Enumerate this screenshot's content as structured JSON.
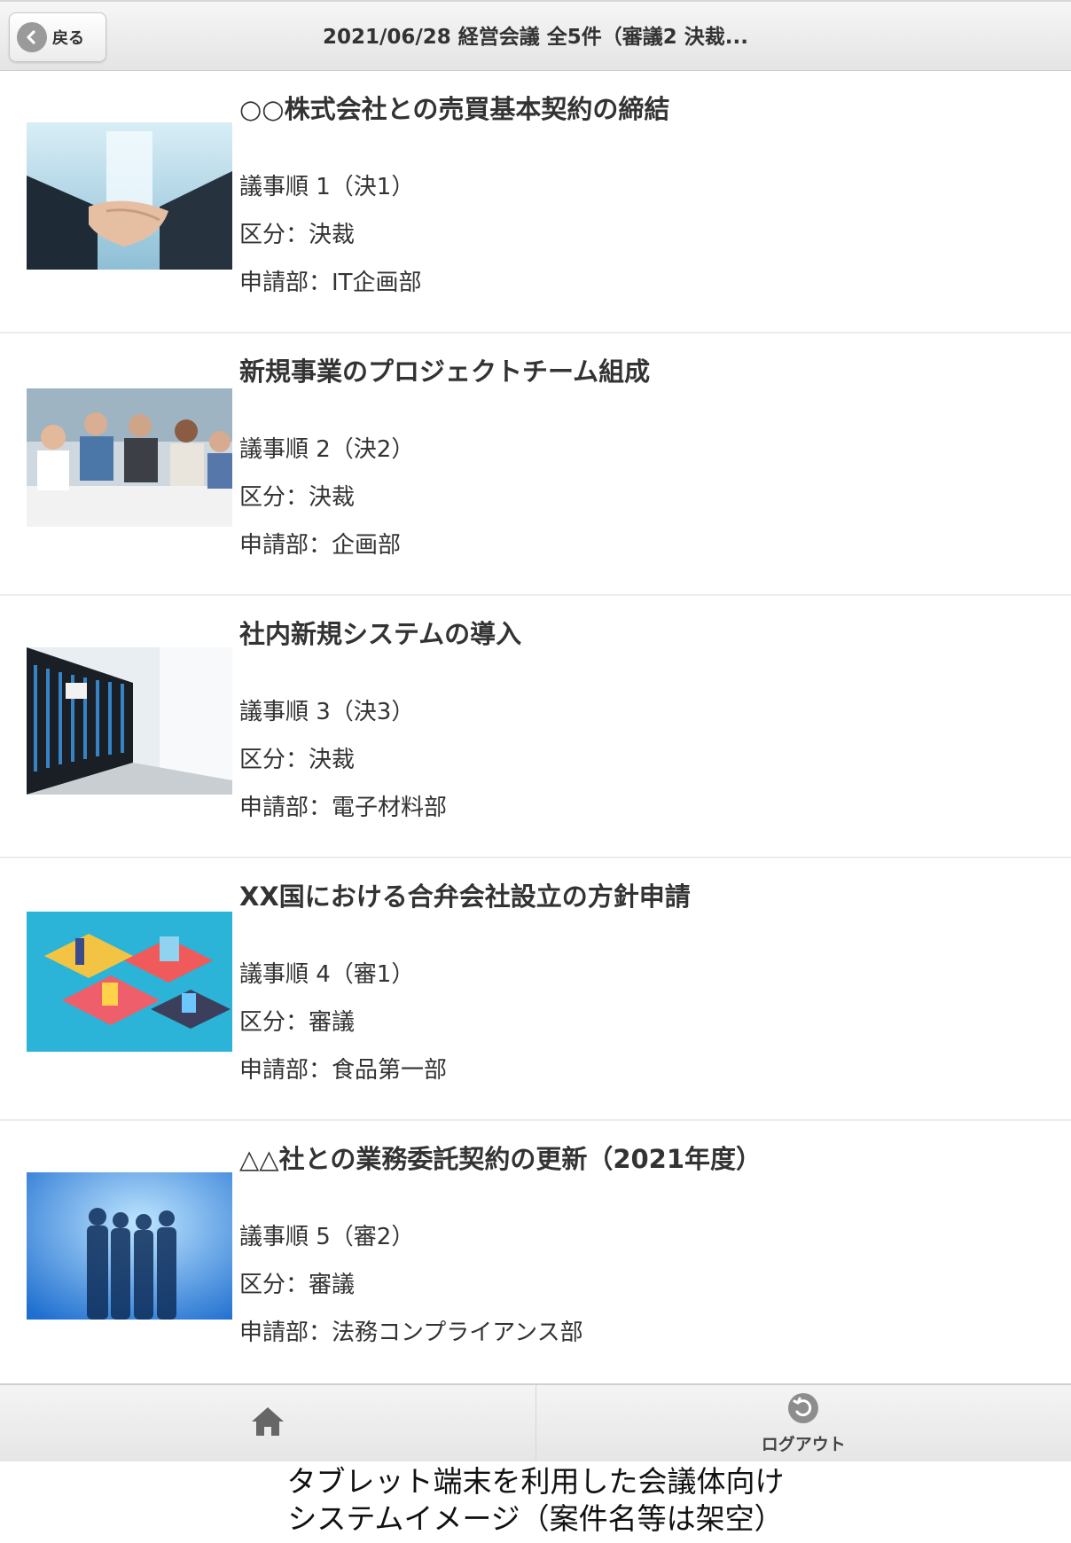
{
  "header": {
    "back_label": "戻る",
    "title": "2021/06/28 経営会議 全5件（審議2 決裁..."
  },
  "items": [
    {
      "title": "○○株式会社との売買基本契約の締結",
      "order": "議事順 1（決1）",
      "category": "区分：決裁",
      "department": "申請部：IT企画部",
      "image": "handshake-photo"
    },
    {
      "title": "新規事業のプロジェクトチーム組成",
      "order": "議事順 2（決2）",
      "category": "区分：決裁",
      "department": "申請部：企画部",
      "image": "meeting-photo"
    },
    {
      "title": "社内新規システムの導入",
      "order": "議事順 3（決3）",
      "category": "区分：決裁",
      "department": "申請部：電子材料部",
      "image": "server-room-photo"
    },
    {
      "title": "XX国における合弁会社設立の方針申請",
      "order": "議事順 4（審1）",
      "category": "区分：審議",
      "department": "申請部：食品第一部",
      "image": "isometric-exhibition-illustration"
    },
    {
      "title": "△△社との業務委託契約の更新（2021年度）",
      "order": "議事順 5（審2）",
      "category": "区分：審議",
      "department": "申請部：法務コンプライアンス部",
      "image": "business-silhouettes-photo"
    }
  ],
  "footer": {
    "home_icon": "home-icon",
    "logout_icon": "logout-icon",
    "logout_label": "ログアウト"
  },
  "caption": {
    "line1": "タブレット端末を利用した会議体向け",
    "line2": "システムイメージ（案件名等は架空）"
  },
  "colors": {
    "header_bg": "#e8e8e8",
    "text": "#333333",
    "divider": "#ececec"
  }
}
